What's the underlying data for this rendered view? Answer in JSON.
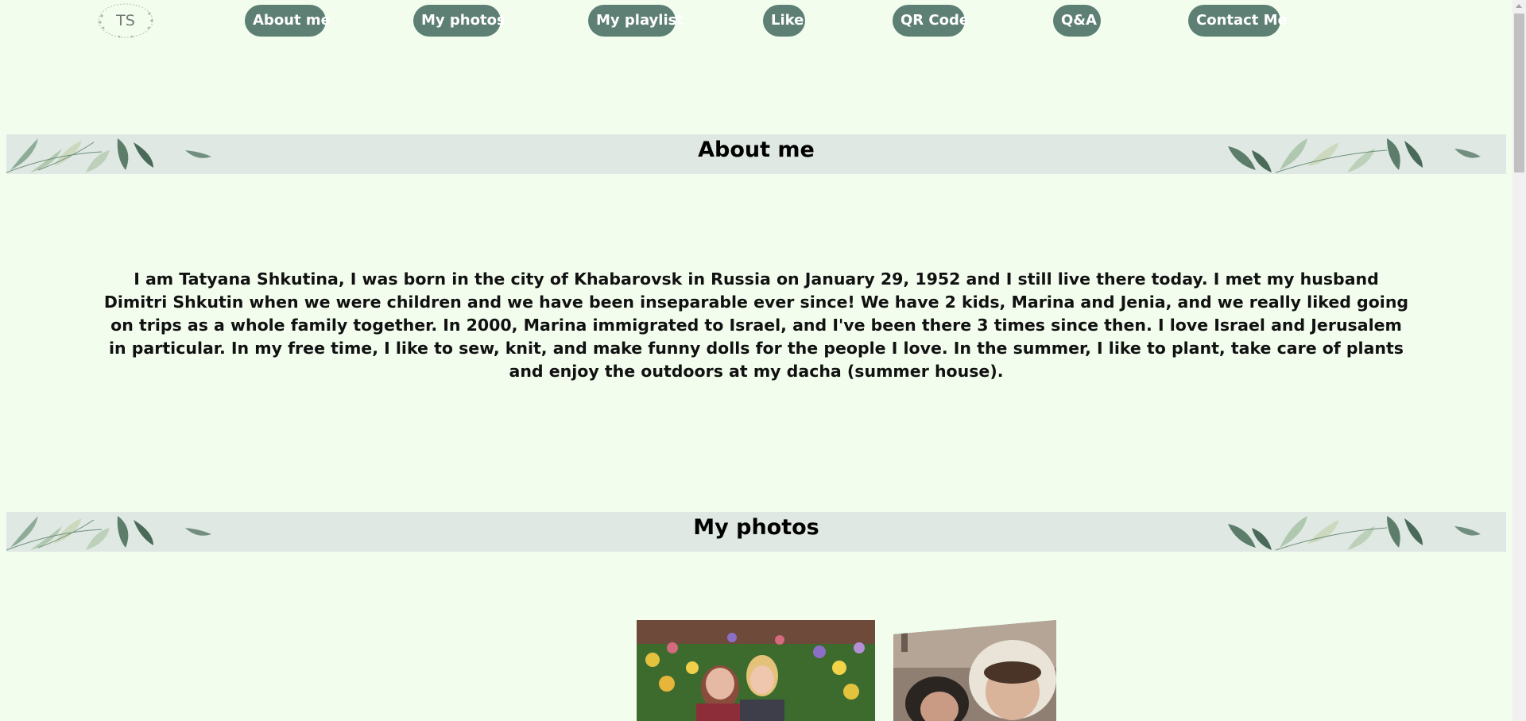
{
  "logo": {
    "text": "TS"
  },
  "nav": {
    "about": "About me",
    "photos": "My photos",
    "playlist": "My playlist",
    "like": "Like",
    "qr": "QR Code",
    "qa": "Q&A",
    "contact": "Contact Me"
  },
  "sections": {
    "about": {
      "title": "About me",
      "text": "I am Tatyana Shkutina, I was born in the city of Khabarovsk in Russia on January 29, 1952 and I still live there today. I met my husband Dimitri Shkutin when we were children and we have been inseparable ever since! We have 2 kids, Marina and Jenia, and we really liked going on trips as a whole family together. In 2000, Marina immigrated to Israel, and I've been there 3 times since then. I love Israel and Jerusalem in particular. In my free time, I like to sew, knit, and make funny dolls for the people I love. In the summer, I like to plant, take care of plants and enjoy the outdoors at my dacha (summer house)."
    },
    "photos": {
      "title": "My photos"
    }
  },
  "colors": {
    "page_background": "#f2fdee",
    "nav_button": "#5d7f74",
    "banner": "#dfe8e3"
  },
  "icons": {
    "logo": "ts-monogram-wreath-icon",
    "banner_decoration": "leaves-decoration"
  }
}
